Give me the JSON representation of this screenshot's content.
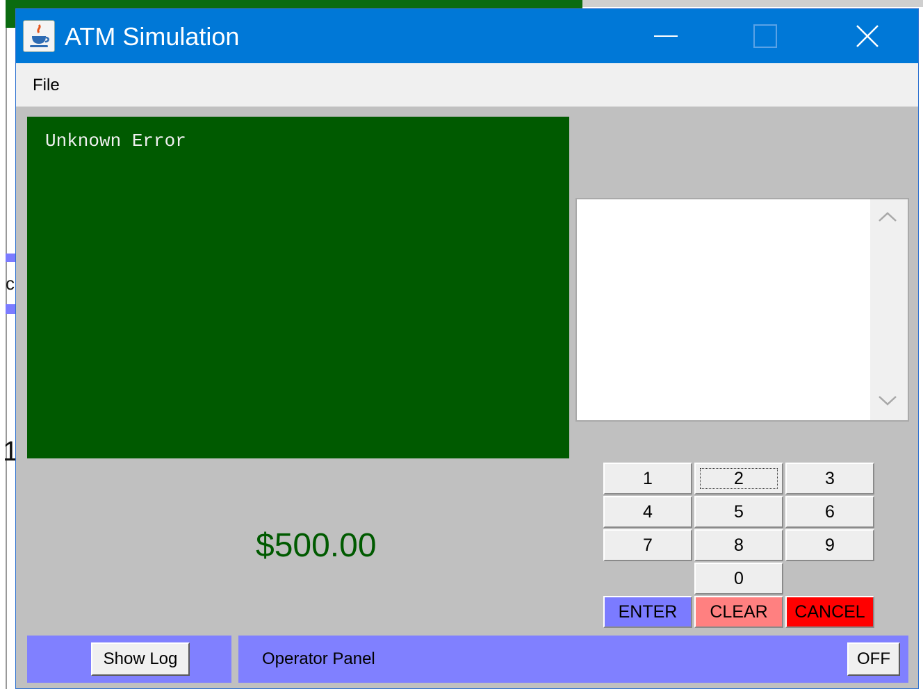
{
  "window": {
    "title": "ATM Simulation"
  },
  "menu": {
    "items": [
      "File"
    ]
  },
  "display": {
    "message": "Unknown Error",
    "cash_dispenser": "$500.00"
  },
  "keypad": {
    "keys": [
      "1",
      "2",
      "3",
      "4",
      "5",
      "6",
      "7",
      "8",
      "9",
      "0"
    ],
    "enter_label": "ENTER",
    "clear_label": "CLEAR",
    "cancel_label": "CANCEL"
  },
  "footer": {
    "show_log_label": "Show Log",
    "operator_panel_label": "Operator Panel",
    "off_label": "OFF"
  },
  "background": {
    "fragment_c": "c",
    "fragment_1": "1"
  },
  "colors": {
    "titlebar": "#0078d7",
    "screen": "#005a00",
    "panel": "#8080ff",
    "enter": "#7b7bff",
    "clear": "#ff8080",
    "cancel": "#ff0000"
  },
  "icons": {
    "app": "java-cup-icon",
    "minimize": "minimize-icon",
    "maximize": "maximize-icon",
    "close": "close-icon",
    "scroll_up": "chevron-up-icon",
    "scroll_down": "chevron-down-icon"
  }
}
